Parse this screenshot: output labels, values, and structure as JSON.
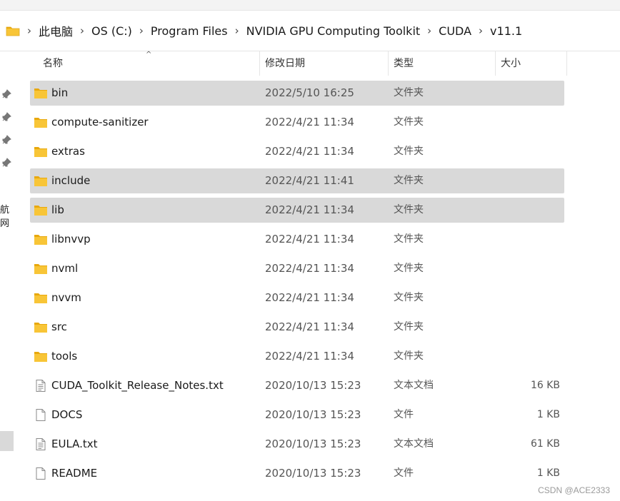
{
  "breadcrumb": {
    "items": [
      "此电脑",
      "OS (C:)",
      "Program Files",
      "NVIDIA GPU Computing Toolkit",
      "CUDA",
      "v11.1"
    ],
    "separator": "›"
  },
  "nav_pane": {
    "truncated_label": "航网"
  },
  "columns": {
    "name": "名称",
    "date": "修改日期",
    "type": "类型",
    "size": "大小",
    "sort_indicator": "^"
  },
  "files": [
    {
      "name": "bin",
      "date": "2022/5/10 16:25",
      "type": "文件夹",
      "size": "",
      "icon": "folder-icon",
      "selected": true
    },
    {
      "name": "compute-sanitizer",
      "date": "2022/4/21 11:34",
      "type": "文件夹",
      "size": "",
      "icon": "folder-icon",
      "selected": false
    },
    {
      "name": "extras",
      "date": "2022/4/21 11:34",
      "type": "文件夹",
      "size": "",
      "icon": "folder-icon",
      "selected": false
    },
    {
      "name": "include",
      "date": "2022/4/21 11:41",
      "type": "文件夹",
      "size": "",
      "icon": "folder-icon",
      "selected": true
    },
    {
      "name": "lib",
      "date": "2022/4/21 11:34",
      "type": "文件夹",
      "size": "",
      "icon": "folder-icon",
      "selected": true
    },
    {
      "name": "libnvvp",
      "date": "2022/4/21 11:34",
      "type": "文件夹",
      "size": "",
      "icon": "folder-icon",
      "selected": false
    },
    {
      "name": "nvml",
      "date": "2022/4/21 11:34",
      "type": "文件夹",
      "size": "",
      "icon": "folder-icon",
      "selected": false
    },
    {
      "name": "nvvm",
      "date": "2022/4/21 11:34",
      "type": "文件夹",
      "size": "",
      "icon": "folder-icon",
      "selected": false
    },
    {
      "name": "src",
      "date": "2022/4/21 11:34",
      "type": "文件夹",
      "size": "",
      "icon": "folder-icon",
      "selected": false
    },
    {
      "name": "tools",
      "date": "2022/4/21 11:34",
      "type": "文件夹",
      "size": "",
      "icon": "folder-icon",
      "selected": false
    },
    {
      "name": "CUDA_Toolkit_Release_Notes.txt",
      "date": "2020/10/13 15:23",
      "type": "文本文档",
      "size": "16 KB",
      "icon": "text-file-icon",
      "selected": false
    },
    {
      "name": "DOCS",
      "date": "2020/10/13 15:23",
      "type": "文件",
      "size": "1 KB",
      "icon": "file-icon",
      "selected": false
    },
    {
      "name": "EULA.txt",
      "date": "2020/10/13 15:23",
      "type": "文本文档",
      "size": "61 KB",
      "icon": "text-file-icon",
      "selected": false
    },
    {
      "name": "README",
      "date": "2020/10/13 15:23",
      "type": "文件",
      "size": "1 KB",
      "icon": "file-icon",
      "selected": false
    }
  ],
  "colors": {
    "folder": "#f8c537",
    "folder_dark": "#e8a80c",
    "selected_row": "#d9d9d9"
  },
  "watermark": "CSDN @ACE2333"
}
